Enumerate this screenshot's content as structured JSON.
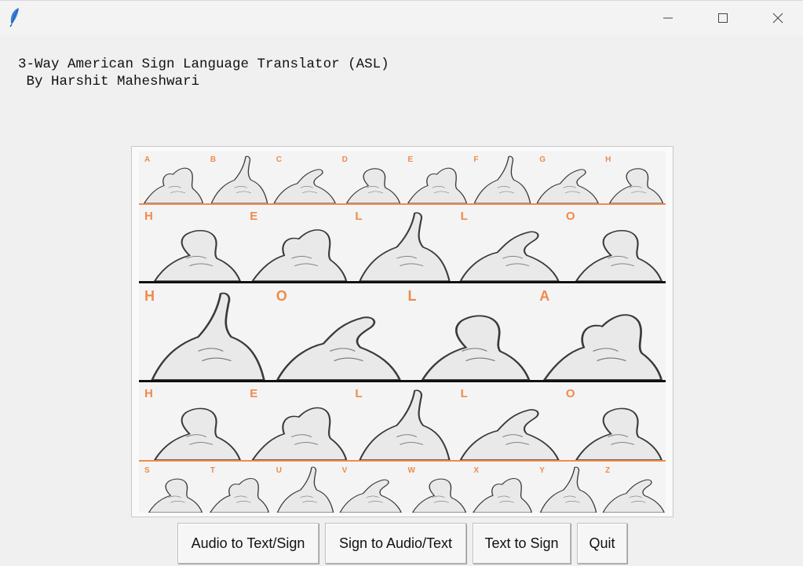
{
  "window": {
    "app_icon": "feather-icon",
    "controls": {
      "minimize": "minimize-icon",
      "maximize": "maximize-icon",
      "close": "close-icon"
    }
  },
  "header": {
    "title": "3-Way American Sign Language Translator (ASL)",
    "subtitle": " By Harshit Maheshwari"
  },
  "image": {
    "top_letters": [
      "A",
      "B",
      "C",
      "D",
      "E",
      "F",
      "G",
      "H"
    ],
    "row_hello_1": [
      "H",
      "E",
      "L",
      "L",
      "O"
    ],
    "row_hola": [
      "H",
      "O",
      "L",
      "A"
    ],
    "row_hello_2": [
      "H",
      "E",
      "L",
      "L",
      "O"
    ],
    "bottom_letters": [
      "S",
      "T",
      "U",
      "V",
      "W",
      "X",
      "Y",
      "Z"
    ],
    "accent_color": "#f08a4b"
  },
  "buttons": {
    "audio_to_text": "Audio to Text/Sign",
    "sign_to_audio": "Sign to Audio/Text",
    "text_to_sign": "Text to Sign",
    "quit": "Quit"
  }
}
